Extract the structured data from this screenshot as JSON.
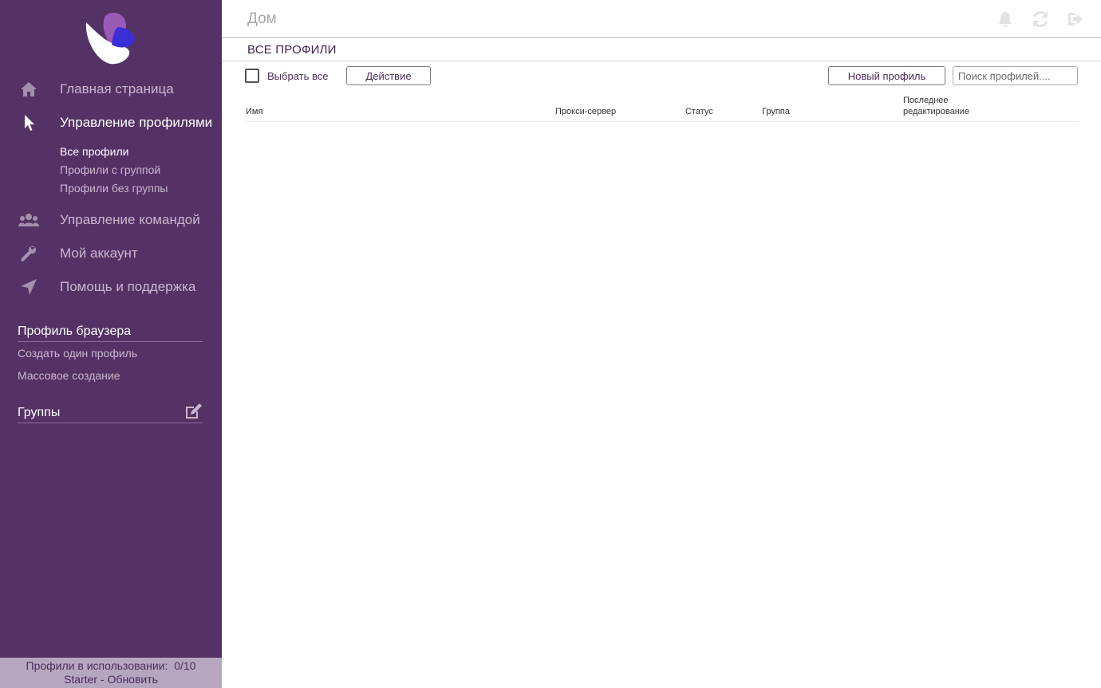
{
  "colors": {
    "sidebar_bg": "#553266",
    "accent": "#4b2e5c",
    "logo_purple": "#9b59b6",
    "logo_blue": "#3a2fd6"
  },
  "sidebar": {
    "nav": [
      {
        "label": "Главная страница",
        "icon": "home-icon"
      },
      {
        "label": "Управление профилями",
        "icon": "cursor-icon"
      },
      {
        "label": "Управление командой",
        "icon": "users-icon"
      },
      {
        "label": "Мой аккаунт",
        "icon": "wrench-icon"
      },
      {
        "label": "Помощь и поддержка",
        "icon": "paper-plane-icon"
      }
    ],
    "sub_items": [
      "Все профили",
      "Профили с группой",
      "Профили без группы"
    ],
    "browser_profile": {
      "title": "Профиль браузера",
      "links": [
        "Создать один профиль",
        "Массовое создание"
      ]
    },
    "groups": {
      "title": "Группы",
      "icon": "edit-icon"
    },
    "footer": {
      "usage_label": "Профили в использовании:",
      "usage_value": "0/10",
      "plan": "Starter",
      "separator": " - ",
      "upgrade": "Обновить"
    }
  },
  "header": {
    "title": "Дом",
    "icons": [
      "bell-icon",
      "refresh-icon",
      "logout-icon"
    ]
  },
  "subheader": {
    "title": "ВСЕ ПРОФИЛИ"
  },
  "toolbar": {
    "select_all": "Выбрать все",
    "action_button": "Действие",
    "new_profile_button": "Новый профиль",
    "search_placeholder": "Поиск профилей...."
  },
  "table": {
    "columns": [
      "Имя",
      "Прокси-сервер",
      "Статус",
      "Группа",
      "Последнее редактирование"
    ],
    "last_col_line1": "Последнее",
    "last_col_line2": "редактирование",
    "rows": []
  }
}
